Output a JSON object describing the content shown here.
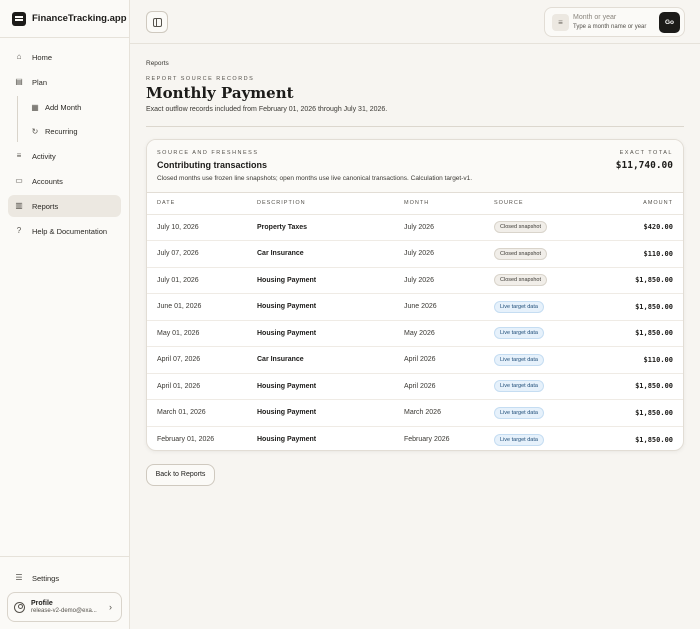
{
  "app": {
    "name": "FinanceTracking.app"
  },
  "sidebar": {
    "items": [
      {
        "label": "Home",
        "icon": "home-icon"
      },
      {
        "label": "Plan",
        "icon": "calendar-icon"
      },
      {
        "label": "Add Month",
        "icon": "calendar-plus-icon"
      },
      {
        "label": "Recurring",
        "icon": "refresh-icon"
      },
      {
        "label": "Activity",
        "icon": "list-icon"
      },
      {
        "label": "Accounts",
        "icon": "wallet-icon"
      },
      {
        "label": "Reports",
        "icon": "bar-chart-icon",
        "active": true
      },
      {
        "label": "Help & Documentation",
        "icon": "help-icon"
      }
    ],
    "settings_label": "Settings",
    "profile": {
      "name": "Profile",
      "email": "release-v2-demo@exa..."
    }
  },
  "header": {
    "search_placeholder": "Month or year",
    "search_hint": "Type a month name or year",
    "go_label": "Go"
  },
  "page": {
    "breadcrumb": "Reports",
    "eyebrow": "REPORT SOURCE RECORDS",
    "title": "Monthly Payment",
    "description": "Exact outflow records included from February 01, 2026 through July 31, 2026."
  },
  "card": {
    "eyebrow": "SOURCE AND FRESHNESS",
    "title": "Contributing transactions",
    "description": "Closed months use frozen line snapshots; open months use live canonical transactions. Calculation target-v1.",
    "total_label": "EXACT TOTAL",
    "total_value": "$11,740.00",
    "columns": [
      "DATE",
      "DESCRIPTION",
      "MONTH",
      "SOURCE",
      "AMOUNT"
    ],
    "rows": [
      {
        "date": "July 10, 2026",
        "description": "Property Taxes",
        "month": "July 2026",
        "source": "Closed snapshot",
        "amount": "$420.00"
      },
      {
        "date": "July 07, 2026",
        "description": "Car Insurance",
        "month": "July 2026",
        "source": "Closed snapshot",
        "amount": "$110.00"
      },
      {
        "date": "July 01, 2026",
        "description": "Housing Payment",
        "month": "July 2026",
        "source": "Closed snapshot",
        "amount": "$1,850.00"
      },
      {
        "date": "June 01, 2026",
        "description": "Housing Payment",
        "month": "June 2026",
        "source": "Live target data",
        "amount": "$1,850.00"
      },
      {
        "date": "May 01, 2026",
        "description": "Housing Payment",
        "month": "May 2026",
        "source": "Live target data",
        "amount": "$1,850.00"
      },
      {
        "date": "April 07, 2026",
        "description": "Car Insurance",
        "month": "April 2026",
        "source": "Live target data",
        "amount": "$110.00"
      },
      {
        "date": "April 01, 2026",
        "description": "Housing Payment",
        "month": "April 2026",
        "source": "Live target data",
        "amount": "$1,850.00"
      },
      {
        "date": "March 01, 2026",
        "description": "Housing Payment",
        "month": "March 2026",
        "source": "Live target data",
        "amount": "$1,850.00"
      },
      {
        "date": "February 01, 2026",
        "description": "Housing Payment",
        "month": "February 2026",
        "source": "Live target data",
        "amount": "$1,850.00"
      }
    ]
  },
  "actions": {
    "back_label": "Back to Reports"
  },
  "colors": {
    "accent": "#1c1b19",
    "closed_badge": "#f1eee9",
    "live_badge": "#e6f1fb"
  }
}
